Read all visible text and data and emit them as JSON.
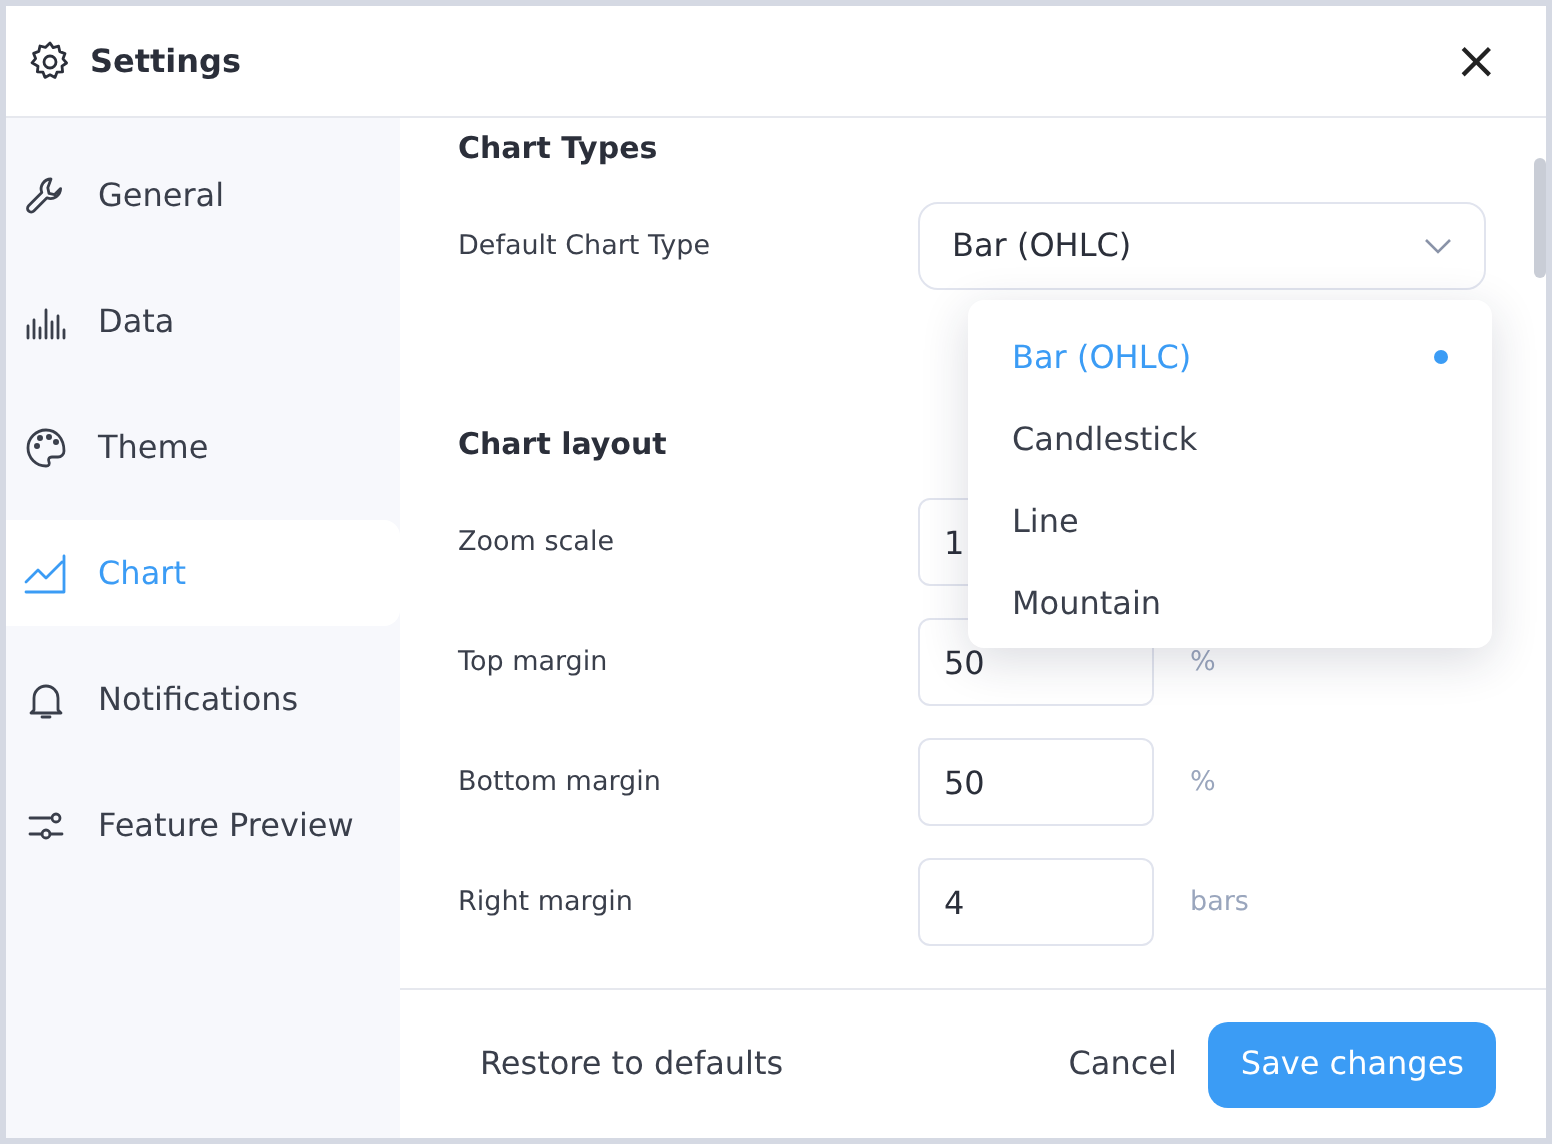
{
  "window": {
    "title": "Settings",
    "close": "×"
  },
  "sidebar": {
    "items": [
      {
        "label": "General",
        "selected": false
      },
      {
        "label": "Data",
        "selected": false
      },
      {
        "label": "Theme",
        "selected": false
      },
      {
        "label": "Chart",
        "selected": true
      },
      {
        "label": "Notifications",
        "selected": false
      },
      {
        "label": "Feature Preview",
        "selected": false
      }
    ]
  },
  "sections": [
    {
      "title": "Chart Types",
      "fields": [
        {
          "kind": "select",
          "label": "Default Chart Type",
          "value": "Bar (OHLC)"
        }
      ]
    },
    {
      "title": "Chart layout",
      "fields": [
        {
          "kind": "number",
          "label": "Zoom scale",
          "value": "1"
        },
        {
          "kind": "number",
          "label": "Top margin",
          "value": "50",
          "unit": "%"
        },
        {
          "kind": "number",
          "label": "Bottom margin",
          "value": "50",
          "unit": "%"
        },
        {
          "kind": "number",
          "label": "Right margin",
          "value": "4",
          "unit": "bars"
        }
      ]
    }
  ],
  "dropdown": {
    "options": [
      {
        "label": "Bar (OHLC)",
        "selected": true
      },
      {
        "label": "Candlestick",
        "selected": false
      },
      {
        "label": "Line",
        "selected": false
      },
      {
        "label": "Mountain",
        "selected": false
      }
    ]
  },
  "footer": {
    "restore": "Restore to defaults",
    "cancel": "Cancel",
    "save": "Save changes"
  }
}
